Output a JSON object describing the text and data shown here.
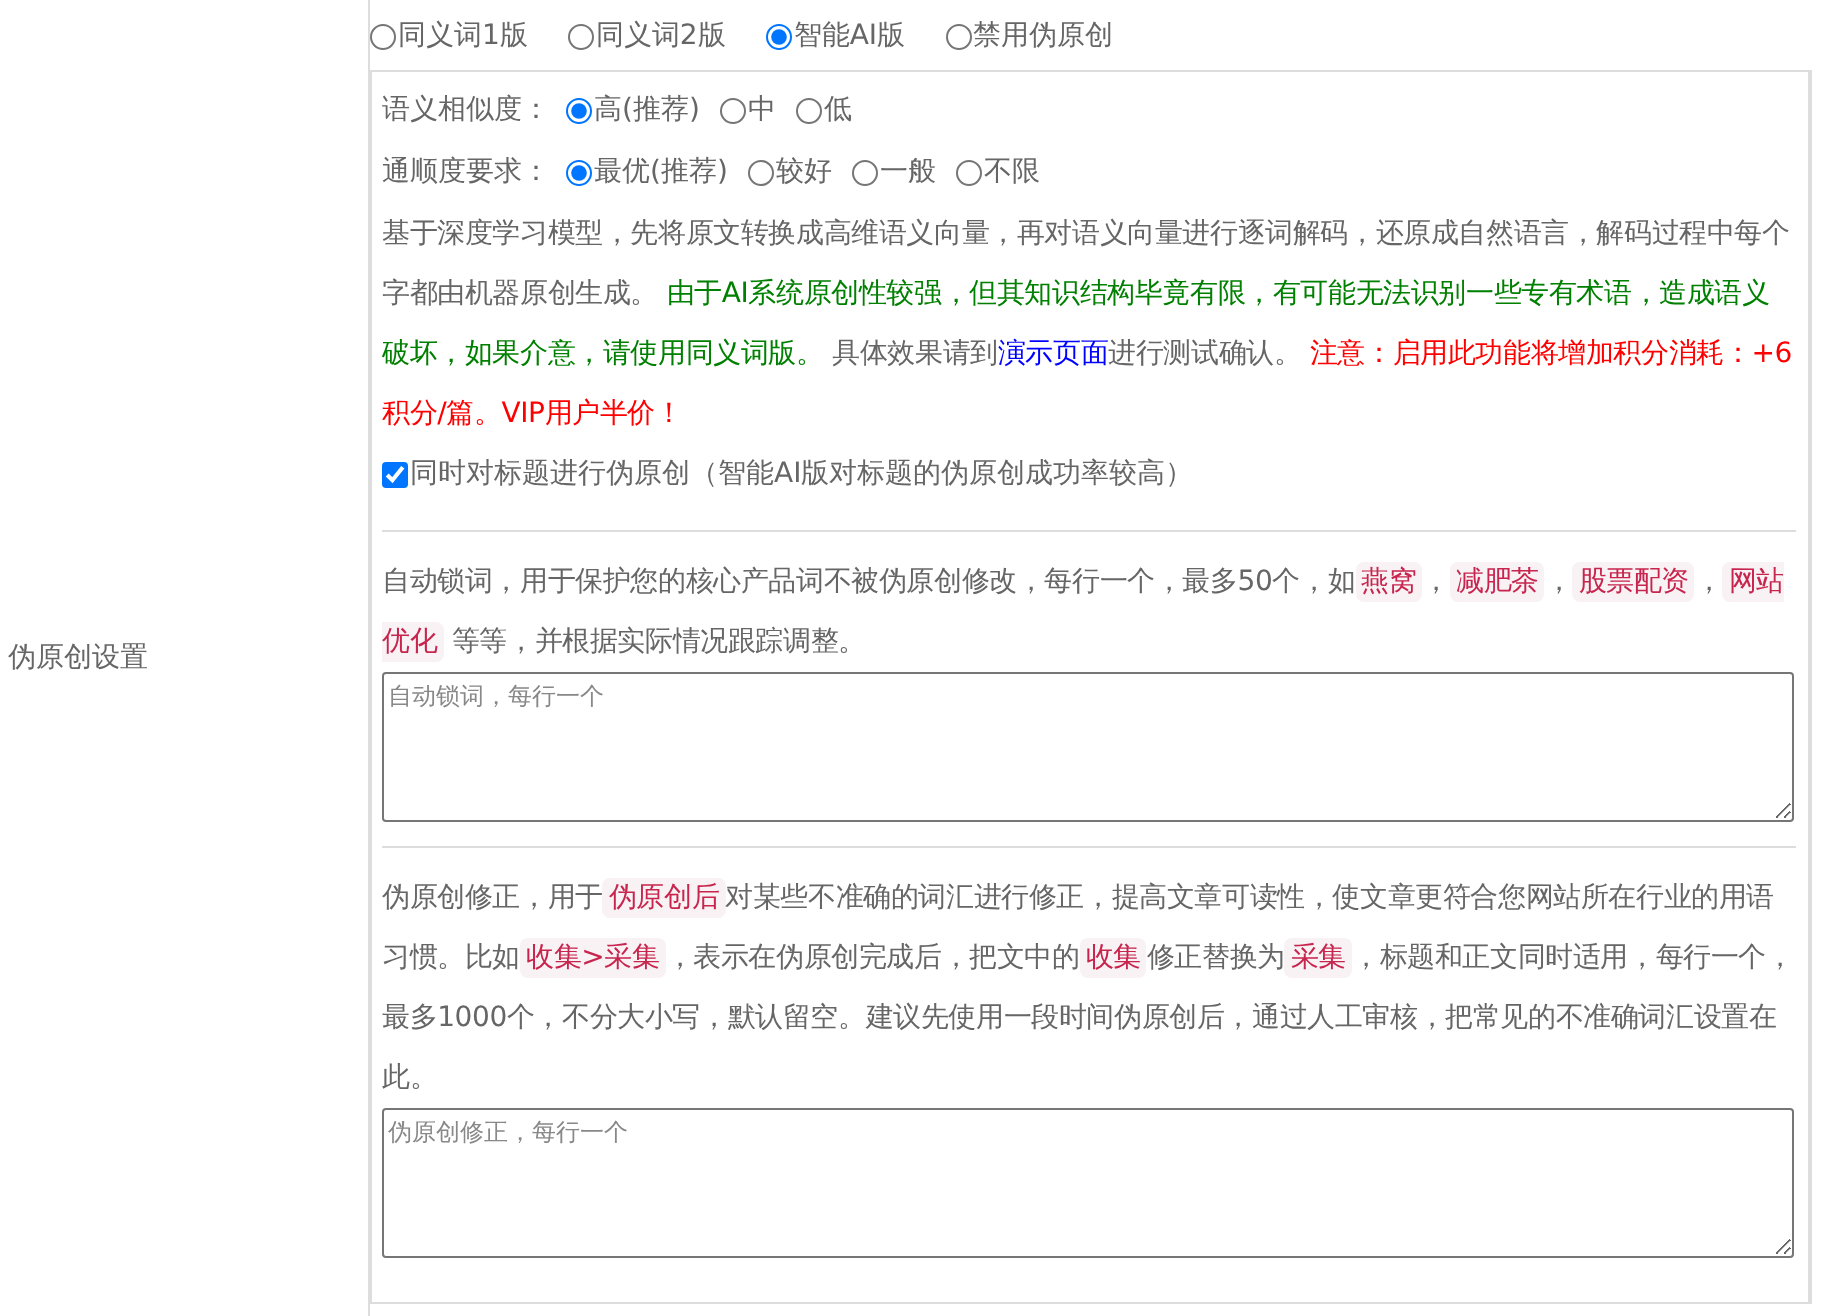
{
  "sidebar_label": "伪原创设置",
  "modes": [
    {
      "label": "同义词1版",
      "selected": false
    },
    {
      "label": "同义词2版",
      "selected": false
    },
    {
      "label": "智能AI版",
      "selected": true
    },
    {
      "label": "禁用伪原创",
      "selected": false
    }
  ],
  "similarity": {
    "label": "语义相似度：",
    "options": [
      {
        "label": "高(推荐)",
        "selected": true
      },
      {
        "label": "中",
        "selected": false
      },
      {
        "label": "低",
        "selected": false
      }
    ]
  },
  "fluency": {
    "label": "通顺度要求：",
    "options": [
      {
        "label": "最优(推荐)",
        "selected": true
      },
      {
        "label": "较好",
        "selected": false
      },
      {
        "label": "一般",
        "selected": false
      },
      {
        "label": "不限",
        "selected": false
      }
    ]
  },
  "ai_note": [
    {
      "kind": "text",
      "text": "基于深度学习模型，先将原文转换成高维语义向量，再对语义向量进行逐词解码，还原成自然语言，解码过程中每个字都由机器原创生成。 "
    },
    {
      "kind": "notice",
      "text": "由于AI系统原创性较强，但其知识结构毕竟有限，有可能无法识别一些专有术语，造成语义破坏，如果介意，请使用同义词版。"
    },
    {
      "kind": "text",
      "text": " 具体效果请到"
    },
    {
      "kind": "link",
      "text": "演示页面"
    },
    {
      "kind": "text",
      "text": "进行测试确认。 "
    },
    {
      "kind": "warning",
      "text": "注意：启用此功能将增加积分消耗：+6积分/篇。VIP用户半价！"
    }
  ],
  "title_option": {
    "label": "同时对标题进行伪原创（智能AI版对标题的伪原创成功率较高）",
    "checked": true
  },
  "lock_words": {
    "description": [
      {
        "kind": "text",
        "text": "自动锁词，用于保护您的核心产品词不被伪原创修改，每行一个，最多50个，如"
      },
      {
        "kind": "keyword",
        "text": "燕窝"
      },
      {
        "kind": "text",
        "text": "，"
      },
      {
        "kind": "keyword",
        "text": "减肥茶"
      },
      {
        "kind": "text",
        "text": "，"
      },
      {
        "kind": "keyword",
        "text": "股票配资"
      },
      {
        "kind": "text",
        "text": "，"
      },
      {
        "kind": "keyword",
        "text": "网站优化"
      },
      {
        "kind": "text",
        "text": " 等等，并根据实际情况跟踪调整。"
      }
    ],
    "placeholder": "自动锁词，每行一个"
  },
  "corrections": {
    "description": [
      {
        "kind": "text",
        "text": "伪原创修正，用于"
      },
      {
        "kind": "keyword",
        "text": "伪原创后"
      },
      {
        "kind": "text",
        "text": "对某些不准确的词汇进行修正，提高文章可读性，使文章更符合您网站所在行业的用语习惯。比如"
      },
      {
        "kind": "keyword",
        "text": "收集>采集"
      },
      {
        "kind": "text",
        "text": "，表示在伪原创完成后，把文中的"
      },
      {
        "kind": "keyword",
        "text": "收集"
      },
      {
        "kind": "text",
        "text": "修正替换为"
      },
      {
        "kind": "keyword",
        "text": "采集"
      },
      {
        "kind": "text",
        "text": "，标题和正文同时适用，每行一个，最多1000个，不分大小写，默认留空。建议先使用一段时间伪原创后，通过人工审核，把常见的不准确词汇设置在此。"
      }
    ],
    "placeholder": "伪原创修正，每行一个"
  }
}
